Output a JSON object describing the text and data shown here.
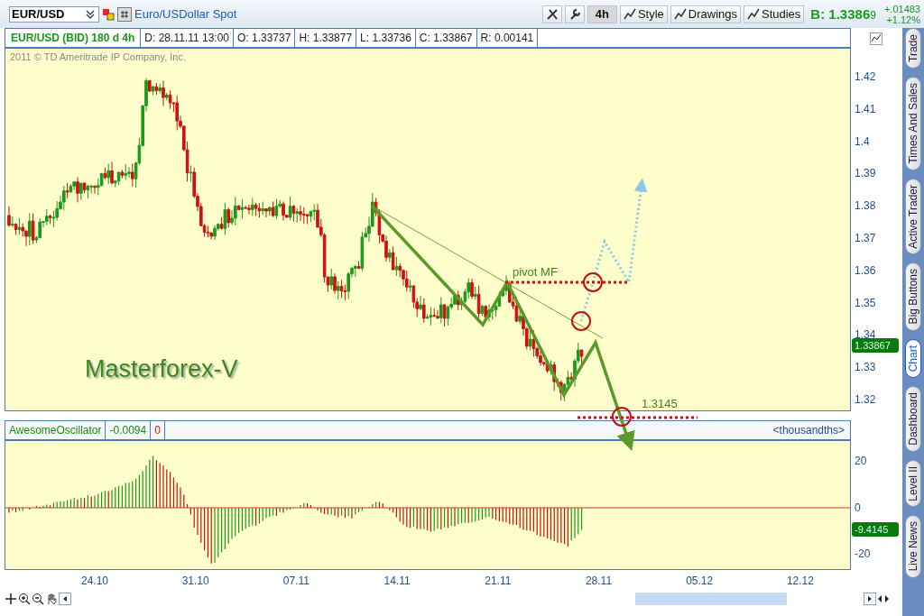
{
  "symbol_bar": {
    "symbol": "EUR/USD",
    "description": "Euro/USDollar Spot",
    "timeframe": "4h",
    "buttons": [
      "Style",
      "Drawings",
      "Studies"
    ],
    "bid_label": "B: 1.3386",
    "bid_last_digit": "9",
    "change": "+.01483",
    "change_pct": "+1.12%"
  },
  "info_row": [
    {
      "kind": "title",
      "text": "EUR/USD (BID) 180 d 4h"
    },
    {
      "kind": "field",
      "text": "D: 28.11.11 13:00"
    },
    {
      "kind": "field",
      "text": "O: 1.33737"
    },
    {
      "kind": "field",
      "text": "H: 1.33877"
    },
    {
      "kind": "field",
      "text": "L: 1.33736"
    },
    {
      "kind": "field",
      "text": "C: 1.33867"
    },
    {
      "kind": "field",
      "text": "R: 0.00141"
    }
  ],
  "price_chart": {
    "copyright": "2011 © TD Ameritrade IP Company, Inc.",
    "overlay_title": "Masterforex-V",
    "price_ticks": [
      "1.42",
      "1.41",
      "1.4",
      "1.39",
      "1.38",
      "1.37",
      "1.36",
      "1.35",
      "1.34",
      "1.33",
      "1.32"
    ],
    "last_price": "1.33867",
    "annotations": [
      {
        "kind": "pivot",
        "text": "pivot MF"
      },
      {
        "kind": "target",
        "text": "1.3145"
      }
    ]
  },
  "oscillator": {
    "name": "AwesomeOscillator",
    "value": "-0.0094",
    "value_2": "0",
    "units": "<thousandths>",
    "ticks": [
      "20",
      "0",
      "-20"
    ],
    "last_value": "-9.4145"
  },
  "time_axis": [
    "24.10",
    "31.10",
    "07.11",
    "14.11",
    "21.11",
    "28.11",
    "05.12",
    "12.12"
  ],
  "side_tabs": [
    {
      "label": "Trade",
      "selected": false
    },
    {
      "label": "Times And Sales",
      "selected": false
    },
    {
      "label": "Active Trader",
      "selected": false
    },
    {
      "label": "Big Buttons",
      "selected": false
    },
    {
      "label": "Chart",
      "selected": true
    },
    {
      "label": "Dashboard",
      "selected": false
    },
    {
      "label": "Level II",
      "selected": false
    },
    {
      "label": "Live News",
      "selected": false
    }
  ]
}
